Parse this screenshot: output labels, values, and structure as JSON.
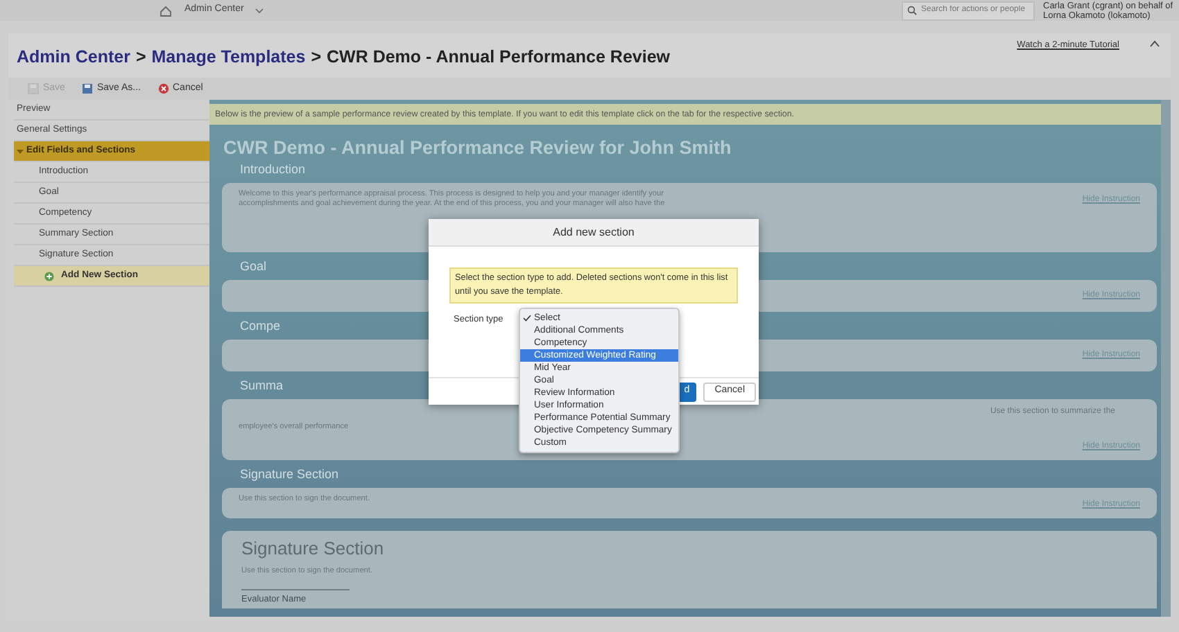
{
  "top_bar": {
    "home_menu": "Admin Center",
    "search": {
      "placeholder": "Search for actions or people"
    },
    "user_lines": [
      "Carla Grant (cgrant) on behalf of",
      "Lorna Okamoto (lokamoto)"
    ]
  },
  "header": {
    "breadcrumbs": [
      {
        "label": "Admin Center",
        "kind": "link"
      },
      {
        "label": ">",
        "kind": "separator"
      },
      {
        "label": "Manage Templates",
        "kind": "link"
      },
      {
        "label": ">",
        "kind": "separator"
      },
      {
        "label": "CWR Demo - Annual Performance Review",
        "kind": "current"
      }
    ],
    "tutorial_link": "Watch a 2-minute Tutorial"
  },
  "toolbar": [
    {
      "label": "Save",
      "kind": "save",
      "disabled": true
    },
    {
      "label": "Save As...",
      "kind": "save_as",
      "disabled": false
    },
    {
      "label": "Cancel",
      "kind": "cancel",
      "disabled": false
    }
  ],
  "sidebar": {
    "items": [
      {
        "label": "Preview",
        "selected": false
      },
      {
        "label": "General Settings",
        "selected": false
      },
      {
        "label": "Edit Fields and Sections",
        "selected": true,
        "expanded": true,
        "children": [
          {
            "label": "Introduction",
            "kind": "section",
            "selected": false
          },
          {
            "label": "Goal",
            "kind": "section",
            "selected": false
          },
          {
            "label": "Competency",
            "kind": "section",
            "selected": false
          },
          {
            "label": "Summary Section",
            "kind": "section",
            "selected": false
          },
          {
            "label": "Signature Section",
            "kind": "section",
            "selected": false
          },
          {
            "label": "Add New Section",
            "kind": "add",
            "selected": true
          }
        ]
      }
    ]
  },
  "preview": {
    "banner": "Below is the preview of a sample performance review created by this template. If you want to edit this template click on the tab for the respective section.",
    "title": "CWR Demo - Annual Performance Review for John Smith",
    "sections": [
      {
        "heading": "Introduction",
        "lines": [
          "Welcome to this year's performance appraisal process. This process is designed to help you and your manager identify your",
          "accomplishments and goal achievement during the year. At the end of this process, you and your manager will also have the"
        ],
        "action": "Hide Instruction"
      },
      {
        "heading": "Goal",
        "action": "Hide Instruction"
      },
      {
        "heading": "Compe",
        "action": "Hide Instruction"
      },
      {
        "heading": "Summa",
        "note": "Use this section to summarize the",
        "lines": [
          "employee's overall performance"
        ],
        "action": "Hide Instruction"
      },
      {
        "heading": "Signature Section",
        "lines": [
          "Use this section to sign the document."
        ],
        "action": "Hide Instruction"
      }
    ],
    "signature_card": {
      "title": "Signature Section",
      "text": "Use this section to sign the document.",
      "field_label": "Evaluator Name"
    }
  },
  "dialog": {
    "title": "Add new section",
    "note": "Select the section type to add. Deleted sections won't come in this list until you save the template.",
    "field_label": "Section type",
    "buttons": [
      {
        "label": "d",
        "kind": "primary"
      },
      {
        "label": "Cancel",
        "kind": "secondary"
      }
    ],
    "options": [
      {
        "label": "Select",
        "selected": true,
        "highlighted": false
      },
      {
        "label": "Additional Comments",
        "selected": false,
        "highlighted": false
      },
      {
        "label": "Competency",
        "selected": false,
        "highlighted": false
      },
      {
        "label": "Customized Weighted Rating",
        "selected": false,
        "highlighted": true
      },
      {
        "label": "Mid Year",
        "selected": false,
        "highlighted": false
      },
      {
        "label": "Goal",
        "selected": false,
        "highlighted": false
      },
      {
        "label": "Review Information",
        "selected": false,
        "highlighted": false
      },
      {
        "label": "User Information",
        "selected": false,
        "highlighted": false
      },
      {
        "label": "Performance Potential Summary",
        "selected": false,
        "highlighted": false
      },
      {
        "label": "Objective Competency Summary",
        "selected": false,
        "highlighted": false
      },
      {
        "label": "Custom",
        "selected": false,
        "highlighted": false
      }
    ]
  }
}
